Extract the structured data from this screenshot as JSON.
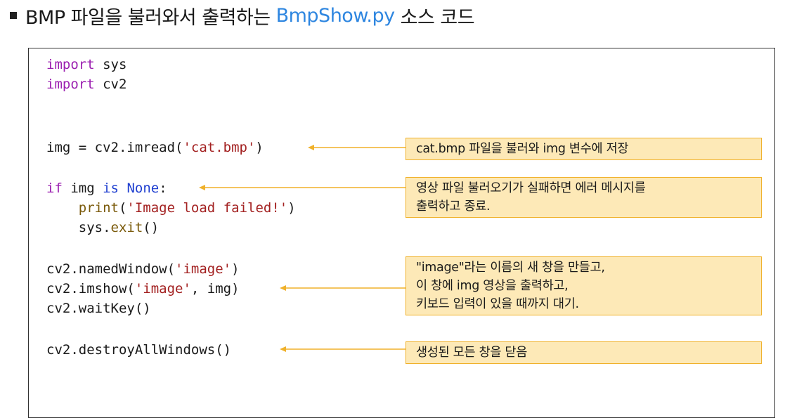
{
  "title": {
    "prefix": "BMP 파일을 불러와서 출력하는",
    "filename": "BmpShow.py",
    "suffix": "소스 코드"
  },
  "code": {
    "line1_kw": "import",
    "line1_rest": " sys",
    "line2_kw": "import",
    "line2_rest": " cv2",
    "line3_a": "img = cv2.imread(",
    "line3_str": "'cat.bmp'",
    "line3_b": ")",
    "line4_if": "if",
    "line4_a": " img ",
    "line4_is": "is",
    "line4_sp": " ",
    "line4_none": "None",
    "line4_b": ":",
    "line5_indent": "    ",
    "line5_fn": "print",
    "line5_a": "(",
    "line5_str": "'Image load failed!'",
    "line5_b": ")",
    "line6_a": "    sys.",
    "line6_fn": "exit",
    "line6_b": "()",
    "line7_a": "cv2.namedWindow(",
    "line7_str": "'image'",
    "line7_b": ")",
    "line8_a": "cv2.imshow(",
    "line8_str": "'image'",
    "line8_b": ", img)",
    "line9": "cv2.waitKey()",
    "line10": "cv2.destroyAllWindows()"
  },
  "notes": {
    "note1": "cat.bmp 파일을 불러와 img 변수에 저장",
    "note2_l1": "영상 파일 불러오기가 실패하면 에러 메시지를",
    "note2_l2": "출력하고 종료.",
    "note3_l1": "\"image\"라는 이름의 새 창을 만들고,",
    "note3_l2": "이 창에 img 영상을 출력하고,",
    "note3_l3": "키보드 입력이 있을 때까지 대기.",
    "note4": "생성된 모든 창을 닫음"
  },
  "colors": {
    "keyword": "#9b1fb0",
    "builtin": "#1f3fd0",
    "string": "#a32121",
    "filename": "#2e86e0",
    "note_fill": "#fde9b7",
    "note_border": "#f0b12a",
    "arrow": "#f0b12a"
  }
}
